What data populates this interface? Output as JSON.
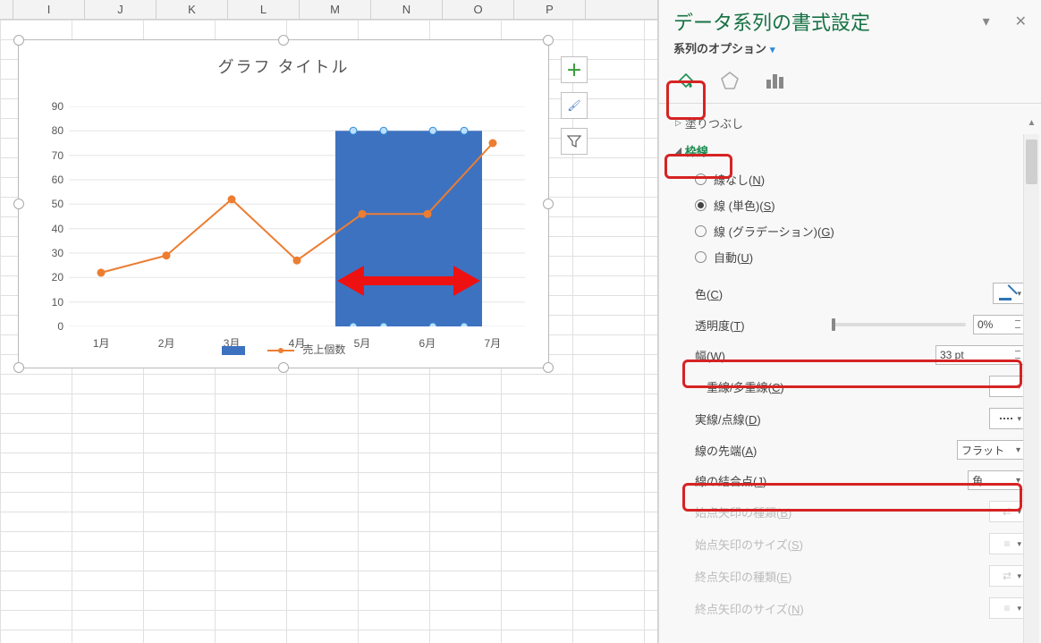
{
  "columns": [
    "I",
    "J",
    "K",
    "L",
    "M",
    "N",
    "O",
    "P"
  ],
  "chart_data": {
    "type": "line",
    "title": "グラフ タイトル",
    "categories": [
      "1月",
      "2月",
      "3月",
      "4月",
      "5月",
      "6月",
      "7月"
    ],
    "series": [
      {
        "name": "売上個数",
        "values": [
          22,
          29,
          52,
          27,
          46,
          46,
          75
        ]
      }
    ],
    "bar_overlay": {
      "categories": [
        "5月",
        "6月"
      ],
      "values": [
        80,
        80
      ]
    },
    "yticks": [
      0,
      10,
      20,
      30,
      40,
      50,
      60,
      70,
      80,
      90
    ],
    "ylim": [
      0,
      90
    ],
    "legend_items": [
      "",
      "売上個数"
    ]
  },
  "legend": {
    "item1": "",
    "item2": "売上個数"
  },
  "panel": {
    "title": "データ系列の書式設定",
    "series_options": "系列のオプション",
    "fill": "塗りつぶし",
    "border": "枠線",
    "radio_none": "線なし(N)",
    "radio_solid": "線 (単色)(S)",
    "radio_grad": "線 (グラデーション)(G)",
    "radio_auto": "自動(U)",
    "color": "色(C)",
    "transparency": "透明度(T)",
    "transparency_val": "0%",
    "width": "幅(W)",
    "width_val": "33 pt",
    "compound": "一重線/多重線(C)",
    "dash": "実線/点線(D)",
    "cap": "線の先端(A)",
    "cap_val": "フラット",
    "join": "線の結合点(J)",
    "join_val": "角",
    "begin_arrow_type": "始点矢印の種類(B)",
    "begin_arrow_size": "始点矢印のサイズ(S)",
    "end_arrow_type": "終点矢印の種類(E)",
    "end_arrow_size": "終点矢印のサイズ(N)"
  }
}
